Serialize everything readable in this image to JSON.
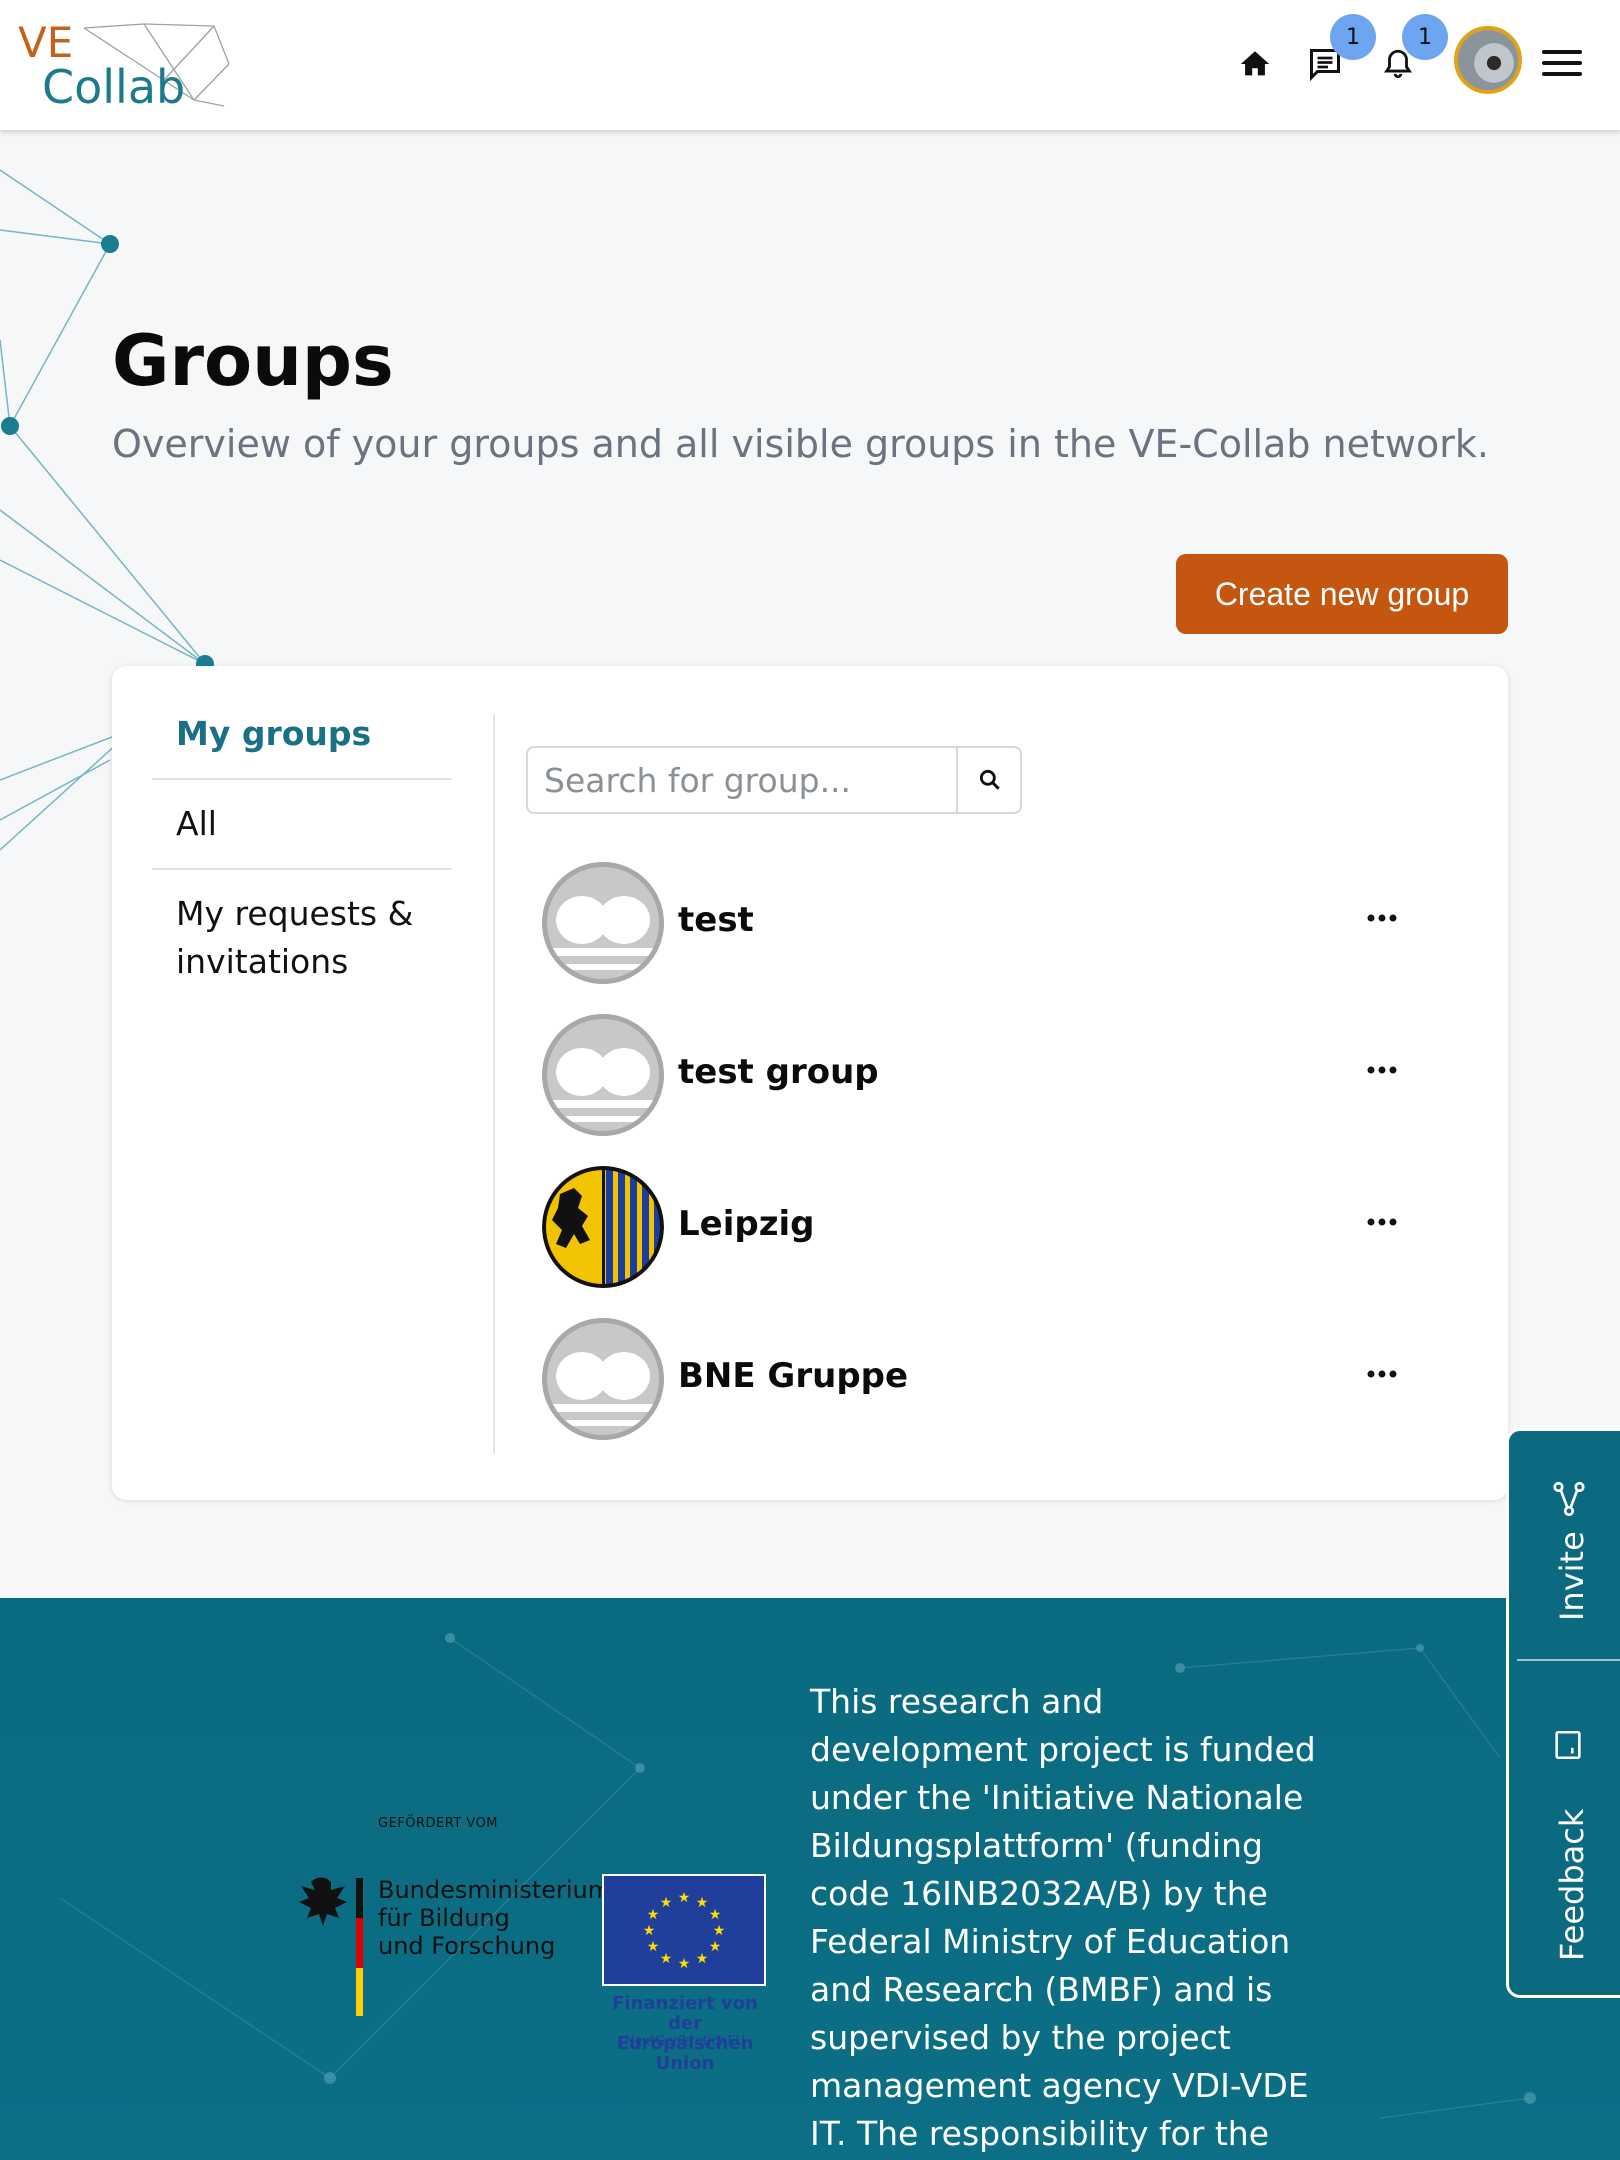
{
  "header": {
    "logo_ve": "VE",
    "logo_collab": "Collab",
    "messages_badge": "1",
    "notifications_badge": "1"
  },
  "main": {
    "title": "Groups",
    "subtitle": "Overview of your groups and all visible groups in the VE-Collab network.",
    "create_button": "Create new group"
  },
  "sidebar": {
    "items": [
      {
        "label": "My groups",
        "active": true
      },
      {
        "label": "All",
        "active": false
      },
      {
        "label": "My requests &",
        "active": false
      },
      {
        "label": "invitations",
        "active": false
      }
    ]
  },
  "search": {
    "placeholder": "Search for group..."
  },
  "groups": [
    {
      "name": "test",
      "avatar": "default-avatar"
    },
    {
      "name": "test group",
      "avatar": "default-avatar"
    },
    {
      "name": "Leipzig",
      "avatar": "leipzig-coat-of-arms"
    },
    {
      "name": "BNE Gruppe",
      "avatar": "default-avatar"
    }
  ],
  "footer": {
    "gefoerdert": "GEFÖRDERT VOM",
    "bmbf_line1": "Bundesministerium",
    "bmbf_line2": "für Bildung",
    "bmbf_line3": "und Forschung",
    "eu_line1": "Finanziert von der",
    "eu_line2": "Europäischen Union",
    "eu_line3": "NextGenerationEU",
    "funding_text": "This research and development project is funded under the 'Initiative Nationale Bildungsplattform' (funding code 16INB2032A/B) by the Federal Ministry of Education and Research (BMBF) and is supervised by the project management agency VDI-VDE IT. The responsibility for the content"
  },
  "sidetab": {
    "invite": "Invite",
    "feedback": "Feedback"
  },
  "colors": {
    "accent_orange": "#c4560f",
    "accent_teal": "#1b7085",
    "footer_bg": "#0a6a80",
    "badge_blue": "#6ea5f0"
  }
}
